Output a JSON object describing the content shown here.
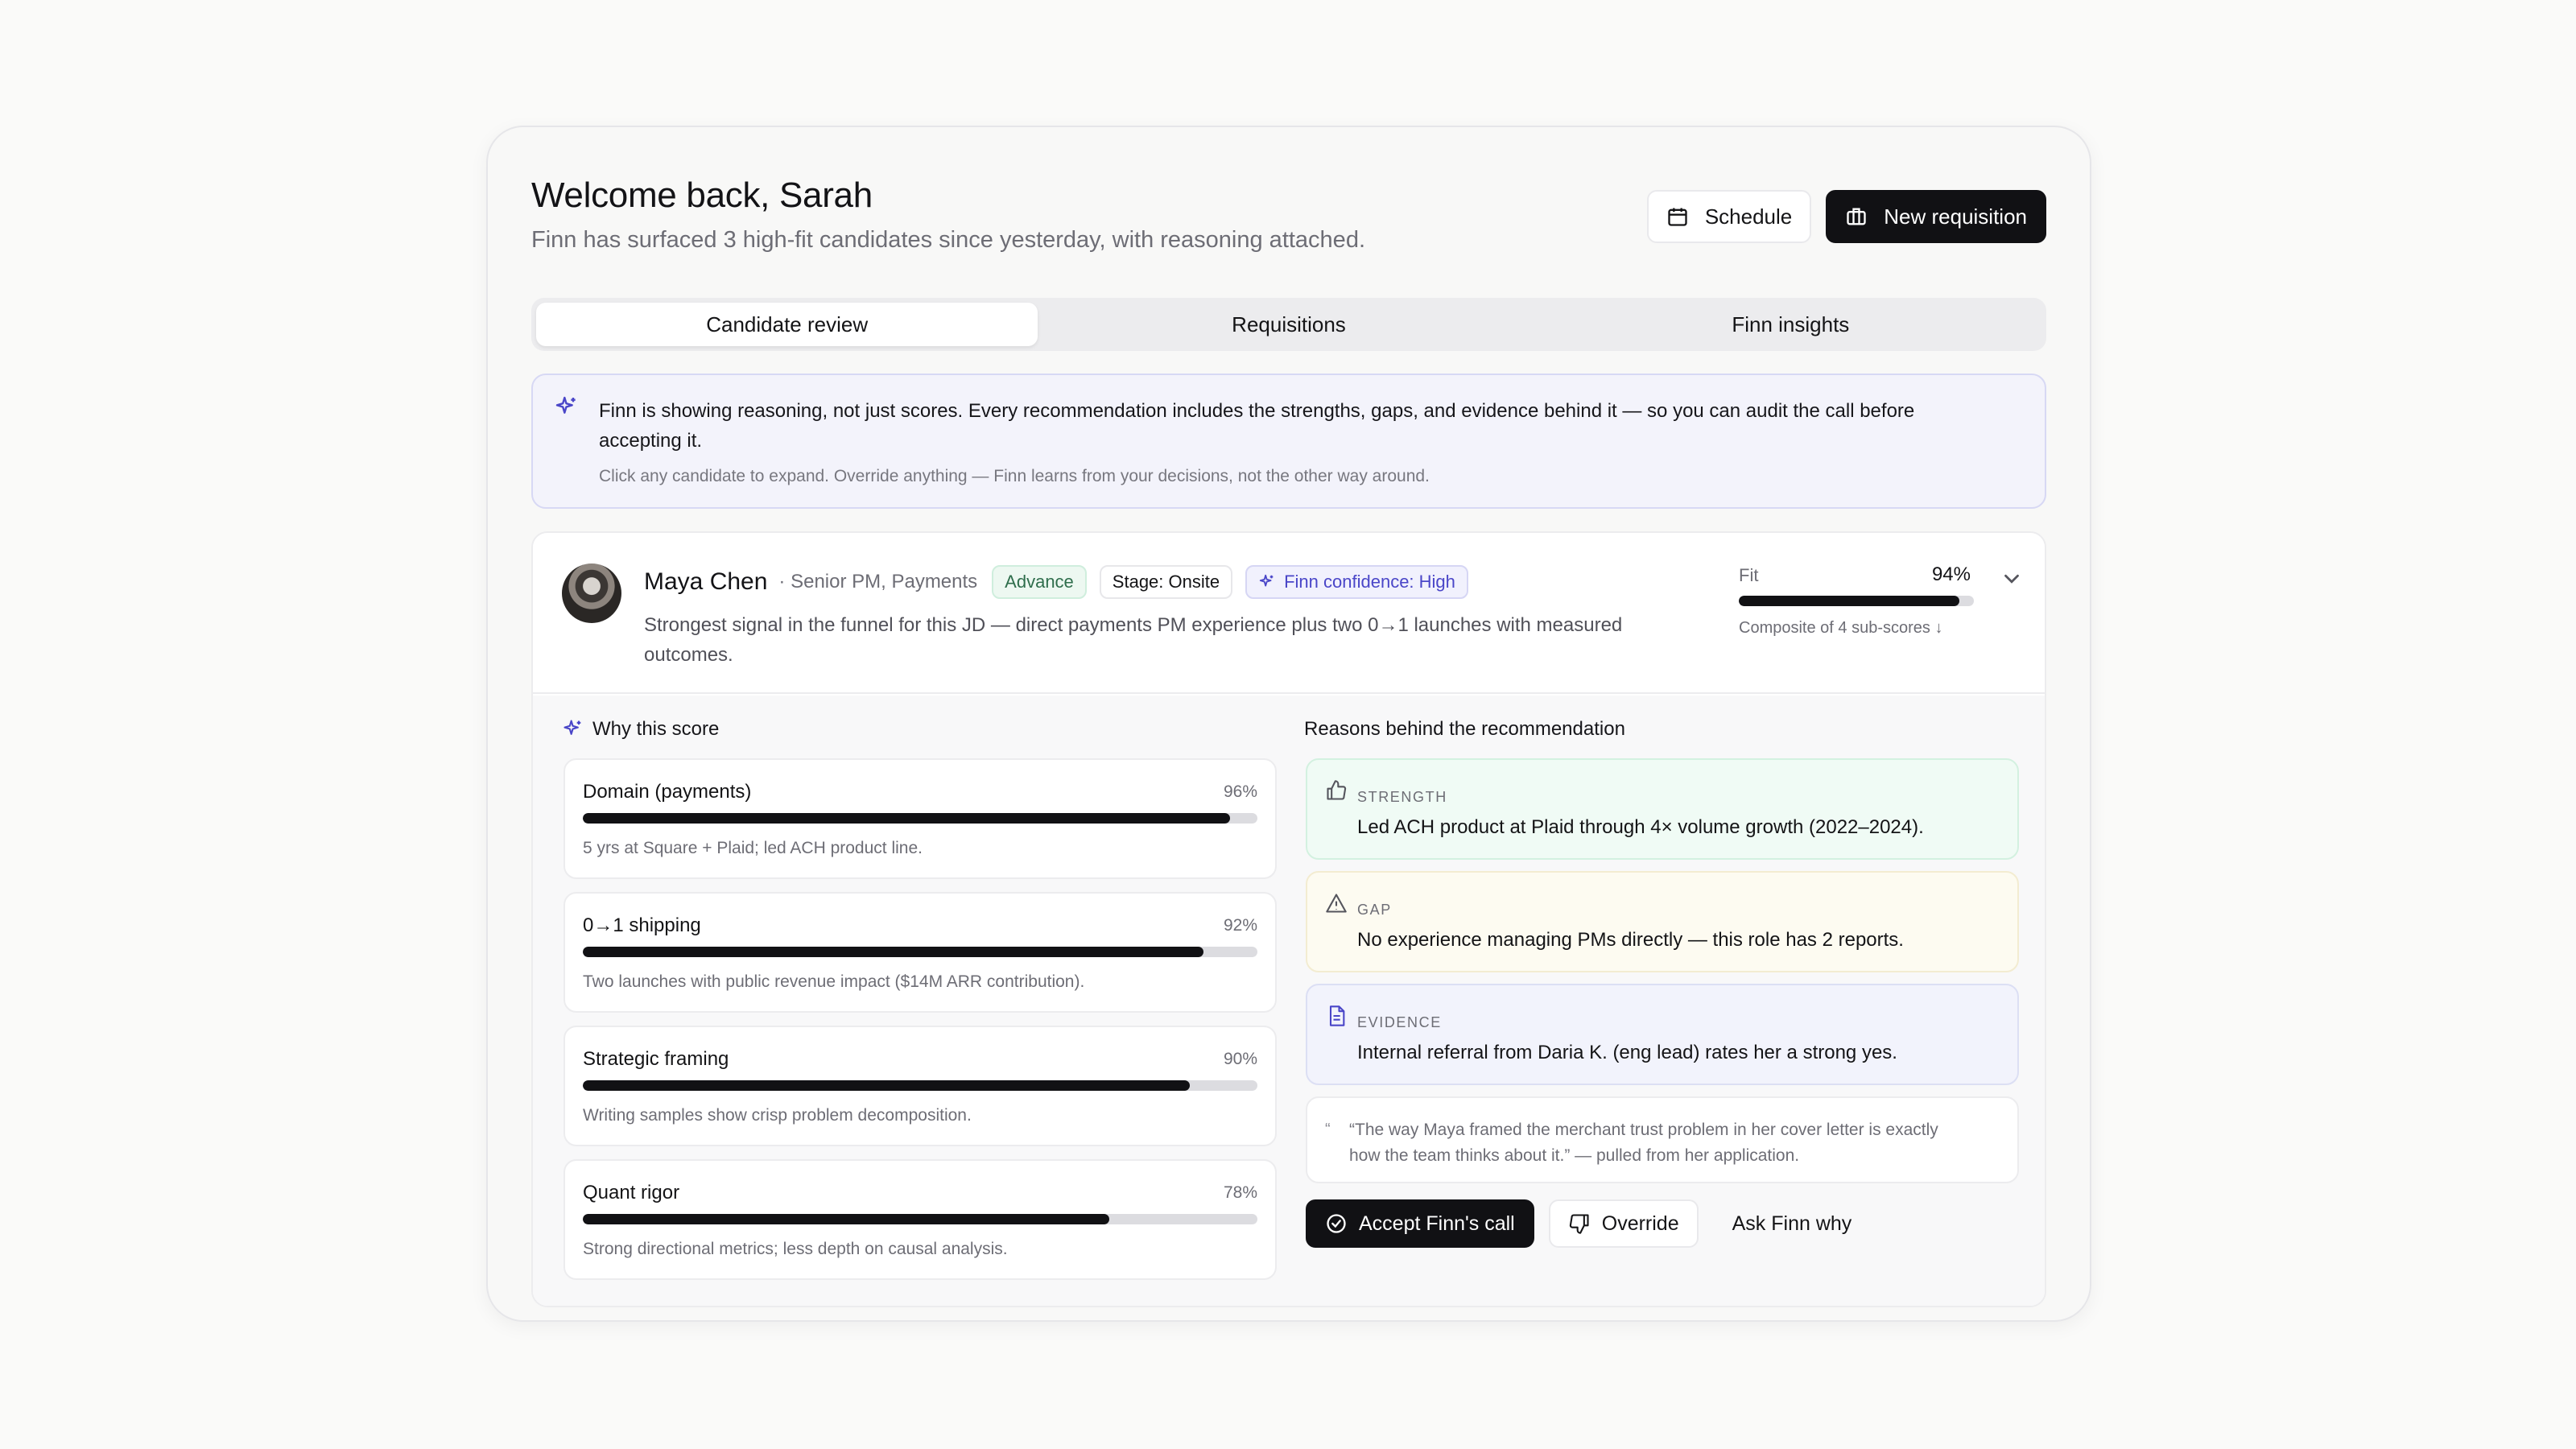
{
  "header": {
    "title": "Welcome back, Sarah",
    "subtitle": "Finn has surfaced 3 high-fit candidates since yesterday, with reasoning attached.",
    "schedule_label": "Schedule",
    "new_requisition_label": "New requisition"
  },
  "tabs": [
    {
      "label": "Candidate review",
      "active": true
    },
    {
      "label": "Requisitions",
      "active": false
    },
    {
      "label": "Finn insights",
      "active": false
    }
  ],
  "banner": {
    "text": "Finn is showing reasoning, not just scores. Every recommendation includes the strengths, gaps, and evidence behind it — so you can audit the call before accepting it.",
    "subtext": "Click any candidate to expand. Override anything — Finn learns from your decisions, not the other way around."
  },
  "candidate": {
    "name": "Maya Chen",
    "role": "· Senior PM, Payments",
    "status_badge": "Advance",
    "stage_badge": "Stage: Onsite",
    "confidence_badge": "Finn confidence: High",
    "summary": "Strongest signal in the funnel for this JD — direct payments PM experience plus two 0→1 launches with measured outcomes.",
    "fit_label": "Fit",
    "fit_value": "94%",
    "fit_fraction": 0.94,
    "fit_note": "Composite of 4 sub-scores ↓"
  },
  "why": {
    "title": "Why this score",
    "scores": [
      {
        "name": "Domain (payments)",
        "pct": "96%",
        "fraction": 0.96,
        "note": "5 yrs at Square + Plaid; led ACH product line."
      },
      {
        "name": "0→1 shipping",
        "pct": "92%",
        "fraction": 0.92,
        "note": "Two launches with public revenue impact ($14M ARR contribution)."
      },
      {
        "name": "Strategic framing",
        "pct": "90%",
        "fraction": 0.9,
        "note": "Writing samples show crisp problem decomposition."
      },
      {
        "name": "Quant rigor",
        "pct": "78%",
        "fraction": 0.78,
        "note": "Strong directional metrics; less depth on causal analysis."
      }
    ]
  },
  "reasons": {
    "title": "Reasons behind the recommendation",
    "items": [
      {
        "kind": "STRENGTH",
        "text": "Led ACH product at Plaid through 4× volume growth (2022–2024).",
        "icon": "thumbs-up-icon"
      },
      {
        "kind": "GAP",
        "text": "No experience managing PMs directly — this role has 2 reports.",
        "icon": "warning-icon"
      },
      {
        "kind": "EVIDENCE",
        "text": "Internal referral from Daria K. (eng lead) rates her a strong yes.",
        "icon": "document-icon"
      }
    ],
    "quote_mark": "“",
    "quote": "“The way Maya framed the merchant trust problem in her cover letter is exactly how the team thinks about it.” — pulled from her application."
  },
  "actions": {
    "accept_label": "Accept Finn's call",
    "override_label": "Override",
    "ask_label": "Ask Finn why"
  },
  "colors": {
    "accent": "#4a46c8",
    "dark": "#111114",
    "strength_bg": "#f0fbf5",
    "gap_bg": "#fdfbf1",
    "evidence_bg": "#f2f3fc"
  }
}
